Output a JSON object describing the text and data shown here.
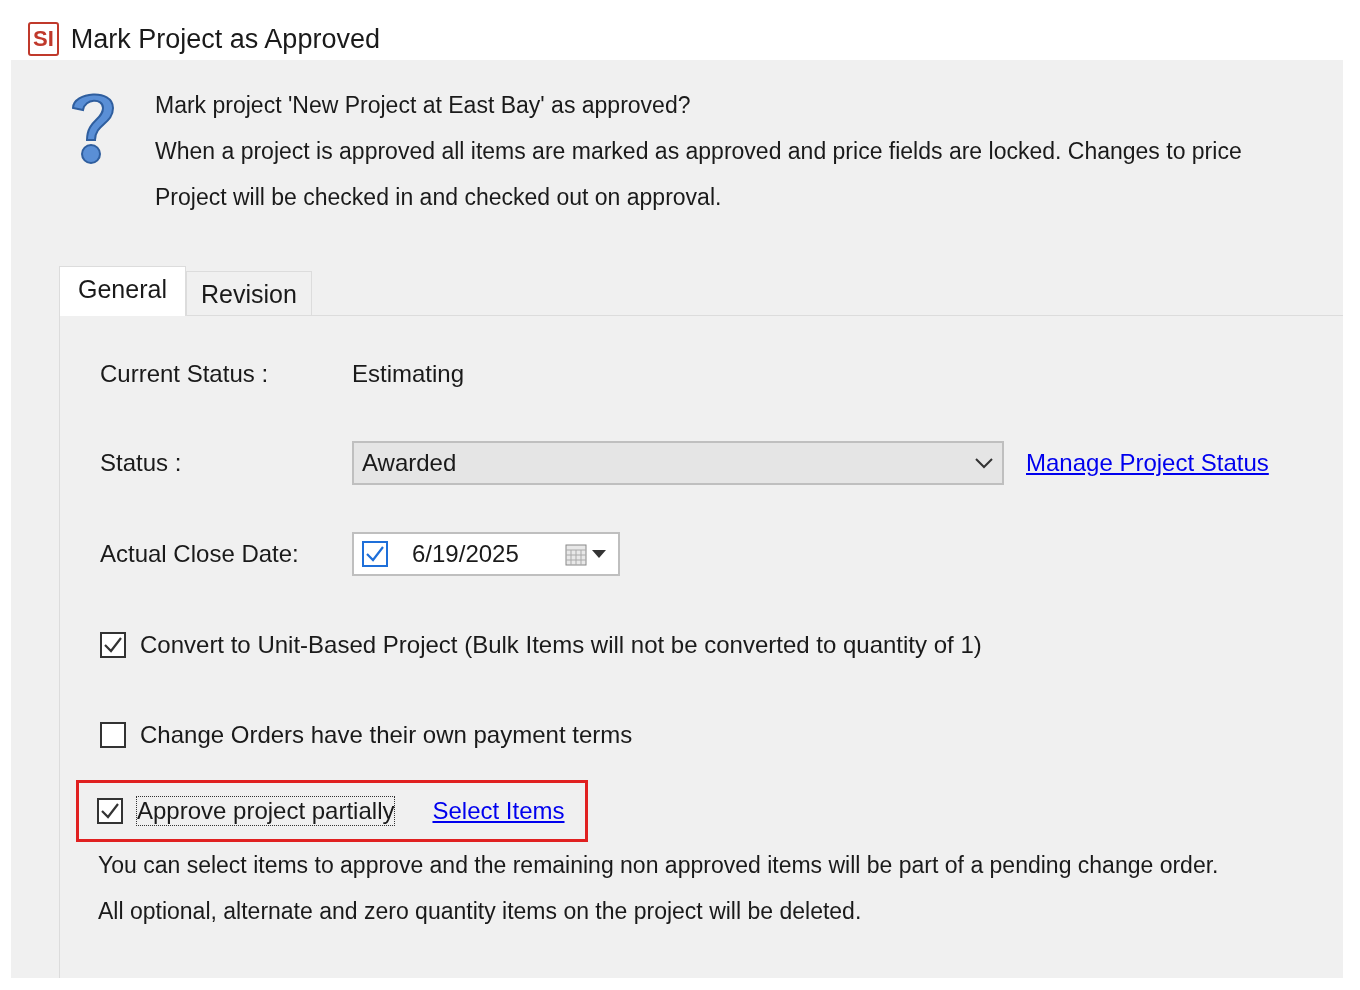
{
  "window": {
    "logo": "SI",
    "title": "Mark Project as Approved"
  },
  "message": {
    "lines": [
      "Mark project 'New Project at East Bay' as approved?",
      "When a project is approved all items are marked as approved and price fields are locked. Changes to price",
      "Project will be checked in and checked out on approval."
    ]
  },
  "tabs": [
    {
      "label": "General",
      "selected": true
    },
    {
      "label": "Revision",
      "selected": false
    }
  ],
  "fields": [
    {
      "kind": "text",
      "label": "Current Status :",
      "value": "Estimating"
    },
    {
      "kind": "select",
      "label": "Status :",
      "value": "Awarded",
      "link": "Manage Project Status"
    },
    {
      "kind": "date",
      "label": "Actual Close Date:",
      "value": "6/19/2025",
      "checked": true
    }
  ],
  "options": [
    {
      "label": "Convert to Unit-Based Project (Bulk Items will not be converted to quantity of 1)",
      "checked": true,
      "highlighted": false,
      "focused": false
    },
    {
      "label": "Change Orders have their own payment terms",
      "checked": false,
      "highlighted": false,
      "focused": false
    },
    {
      "label": "Approve project partially",
      "checked": true,
      "highlighted": true,
      "focused": true,
      "link": "Select Items"
    }
  ],
  "notes": [
    "You can select items to approve and the remaining non approved items will be part of a pending change order.",
    "All optional, alternate and zero quantity items on the project will be deleted."
  ]
}
